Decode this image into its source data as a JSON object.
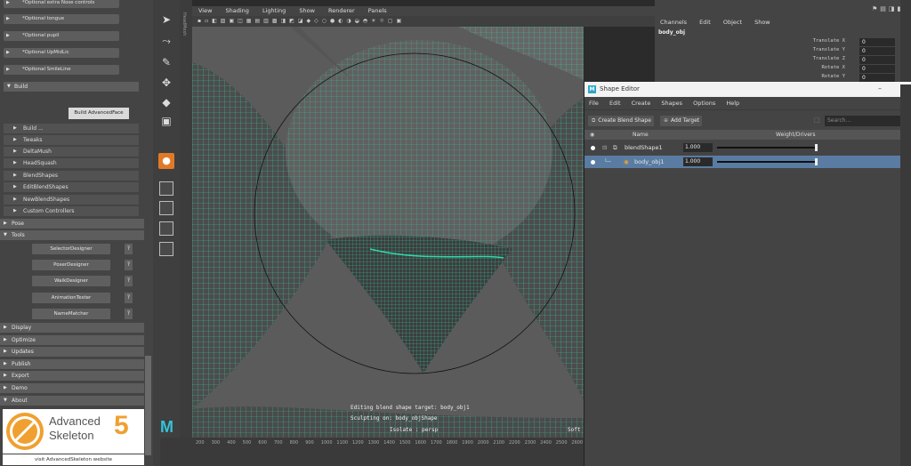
{
  "left_panel": {
    "optional_items": [
      "*Optional extra Nose controls",
      "*Optional tongue",
      "*Optional pupil",
      "*Optional UpMidLic",
      "*Optional SmileLine"
    ],
    "build_section": "Build",
    "build_advanced_button": "Build AdvancedFace",
    "sub_items": [
      "Build ...",
      "Tweaks",
      "DeltaMush",
      "HeadSquash",
      "BlendShapes",
      "EditBlendShapes",
      "NewBlendShapes",
      "Custom Controllers"
    ],
    "pose_section": "Pose",
    "tools_section": "Tools",
    "tool_buttons": [
      "SelectorDesigner",
      "PoserDesigner",
      "WalkDesigner",
      "AnimationTester",
      "NameMatcher"
    ],
    "help_label": "?",
    "bottom_sections": [
      "Display",
      "Optimize",
      "Updates",
      "Publish",
      "Export",
      "Demo",
      "About"
    ],
    "logo_line1": "Advanced",
    "logo_line2": "Skeleton",
    "logo_number": "5",
    "visit_link": "visit AdvancedSkeleton website"
  },
  "viewport": {
    "side_label": "HeadMesh",
    "menu": [
      "View",
      "Shading",
      "Lighting",
      "Show",
      "Renderer",
      "Panels"
    ],
    "hud_line1": "Editing blend shape target: body_obj1",
    "hud_line2": "Sculpting on: body_objShape",
    "hud_line3": "Isolate : persp",
    "hud_corner": "Soft",
    "timeline_ticks": [
      "200",
      "300",
      "400",
      "500",
      "600",
      "700",
      "800",
      "900",
      "1000",
      "1100",
      "1200",
      "1300",
      "1400",
      "1500",
      "1600",
      "1700",
      "1800",
      "1900",
      "2000",
      "2100",
      "2200",
      "2300",
      "2400",
      "2500",
      "2600"
    ],
    "mesh_color": "#2fd9a9"
  },
  "channel_box": {
    "menu": [
      "Channels",
      "Edit",
      "Object",
      "Show"
    ],
    "object": "body_obj",
    "rows": [
      {
        "label": "Translate X",
        "value": "0"
      },
      {
        "label": "Translate Y",
        "value": "0"
      },
      {
        "label": "Translate Z",
        "value": "0"
      },
      {
        "label": "Rotate X",
        "value": "0"
      },
      {
        "label": "Rotate Y",
        "value": "0"
      }
    ]
  },
  "shape_editor": {
    "title": "Shape Editor",
    "menu": [
      "File",
      "Edit",
      "Create",
      "Shapes",
      "Options",
      "Help"
    ],
    "create_blend_shape": "Create Blend Shape",
    "add_target": "Add Target",
    "search_placeholder": "Search...",
    "col_name": "Name",
    "col_weight": "Weight/Drivers",
    "rows": [
      {
        "name": "blendShape1",
        "weight": "1.000"
      },
      {
        "name": "body_obj1",
        "weight": "1.000"
      }
    ],
    "selection_color": "#5a7ca3"
  }
}
